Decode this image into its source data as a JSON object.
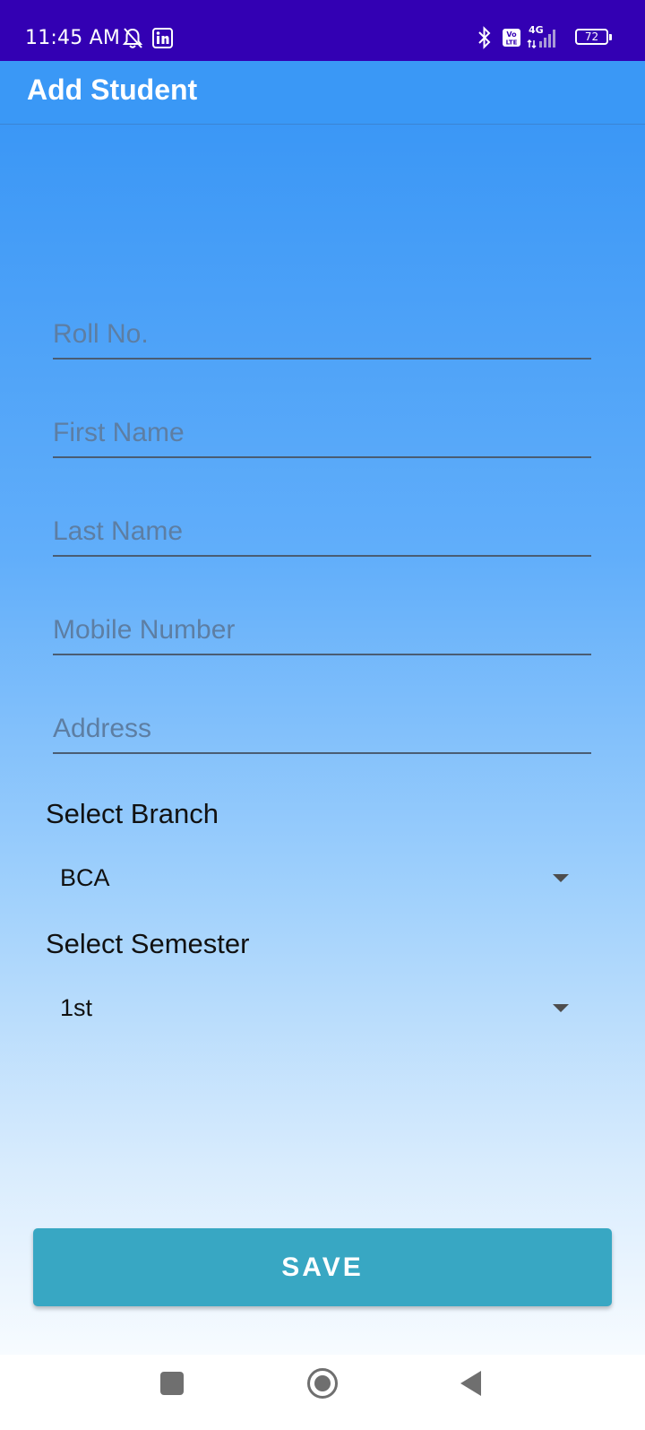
{
  "status_bar": {
    "time": "11:45 AM",
    "network": "4G",
    "battery": "72",
    "icons": [
      "muted-bell-icon",
      "linkedin-icon",
      "bluetooth-icon",
      "volte-icon",
      "signal-icon",
      "battery-icon"
    ]
  },
  "app_bar": {
    "title": "Add Student"
  },
  "form": {
    "roll_placeholder": "Roll No.",
    "first_name_placeholder": "First Name",
    "last_name_placeholder": "Last Name",
    "mobile_placeholder": "Mobile Number",
    "address_placeholder": "Address",
    "branch_label": "Select Branch",
    "branch_value": "BCA",
    "semester_label": "Select Semester",
    "semester_value": "1st",
    "save_label": "SAVE"
  },
  "nav_bar": {
    "icons": [
      "recents-square-icon",
      "home-circle-icon",
      "back-triangle-icon"
    ]
  },
  "colors": {
    "status_bar": "#3300b3",
    "app_bar": "#3a98f6",
    "save_button": "#38a7c3",
    "underline": "#4a5d73",
    "placeholder": "#5d7ea3"
  }
}
